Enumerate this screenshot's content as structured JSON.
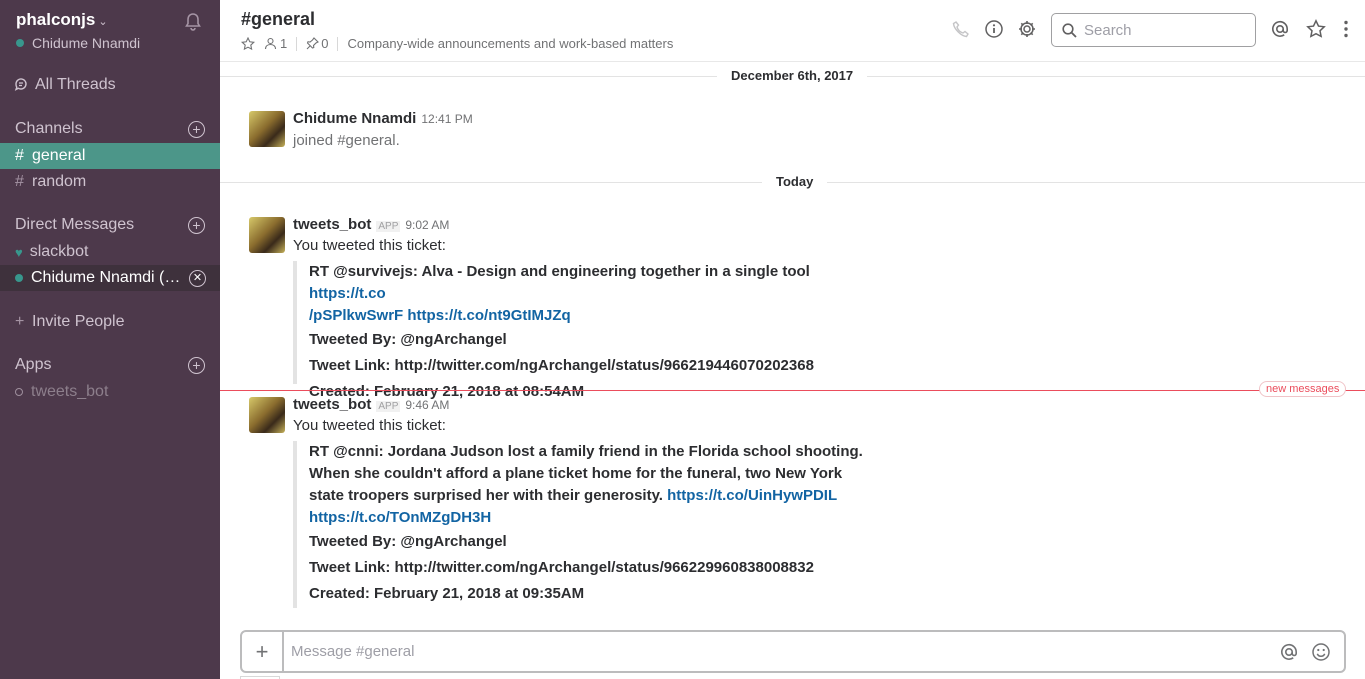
{
  "sidebar": {
    "team_name": "phalconjs",
    "user_name": "Chidume Nnamdi",
    "all_threads": "All Threads",
    "channels_heading": "Channels",
    "channels": [
      {
        "label": "general",
        "active": true
      },
      {
        "label": "random",
        "active": false
      }
    ],
    "dm_heading": "Direct Messages",
    "dms": [
      {
        "label": "slackbot"
      },
      {
        "label": "Chidume Nnamdi  (…"
      }
    ],
    "invite": "Invite People",
    "apps_heading": "Apps",
    "apps": [
      {
        "label": "tweets_bot"
      }
    ],
    "colors": {
      "bg": "#4d394b",
      "active": "#4c9689",
      "presence": "#38978d"
    }
  },
  "header": {
    "channel_title": "#general",
    "members_count": "1",
    "pinned_count": "0",
    "topic": "Company-wide announcements and work-based matters",
    "search_placeholder": "Search"
  },
  "messages": {
    "date_divider_1": "December 6th, 2017",
    "date_divider_2": "Today",
    "new_messages_label": "new messages",
    "items": [
      {
        "sender": "Chidume Nnamdi",
        "time": "12:41 PM",
        "text": "joined #general."
      },
      {
        "sender": "tweets_bot",
        "badge": "APP",
        "time": "9:02 AM",
        "text": "You tweeted this ticket:",
        "attachment": {
          "line1": "RT @survivejs: Alva - Design and engineering together in a single tool ",
          "link1a": "https://t.co",
          "link1b": "/pSPlkwSwrF",
          "link1c": "https://t.co/nt9GtIMJZq",
          "tweeted_by": "Tweeted By: @ngArchangel",
          "tweet_link": "Tweet Link: http://twitter.com/ngArchangel/status/966219446070202368",
          "created": "Created: February 21, 2018 at 08:54AM"
        }
      },
      {
        "sender": "tweets_bot",
        "badge": "APP",
        "time": "9:46 AM",
        "text": "You tweeted this ticket:",
        "attachment": {
          "line1": "RT @cnni: Jordana Judson lost a family friend in the Florida school shooting.",
          "line2": "When she couldn't afford a plane ticket home for the funeral, two New York",
          "line3": "state troopers surprised her with their generosity. ",
          "link1": "https://t.co/UinHywPDIL",
          "link2": "https://t.co/TOnMZgDH3H",
          "tweeted_by": "Tweeted By: @ngArchangel",
          "tweet_link": "Tweet Link: http://twitter.com/ngArchangel/status/966229960838008832",
          "created": "Created: February 21, 2018 at 09:35AM"
        }
      }
    ]
  },
  "composer": {
    "placeholder": "Message #general"
  }
}
